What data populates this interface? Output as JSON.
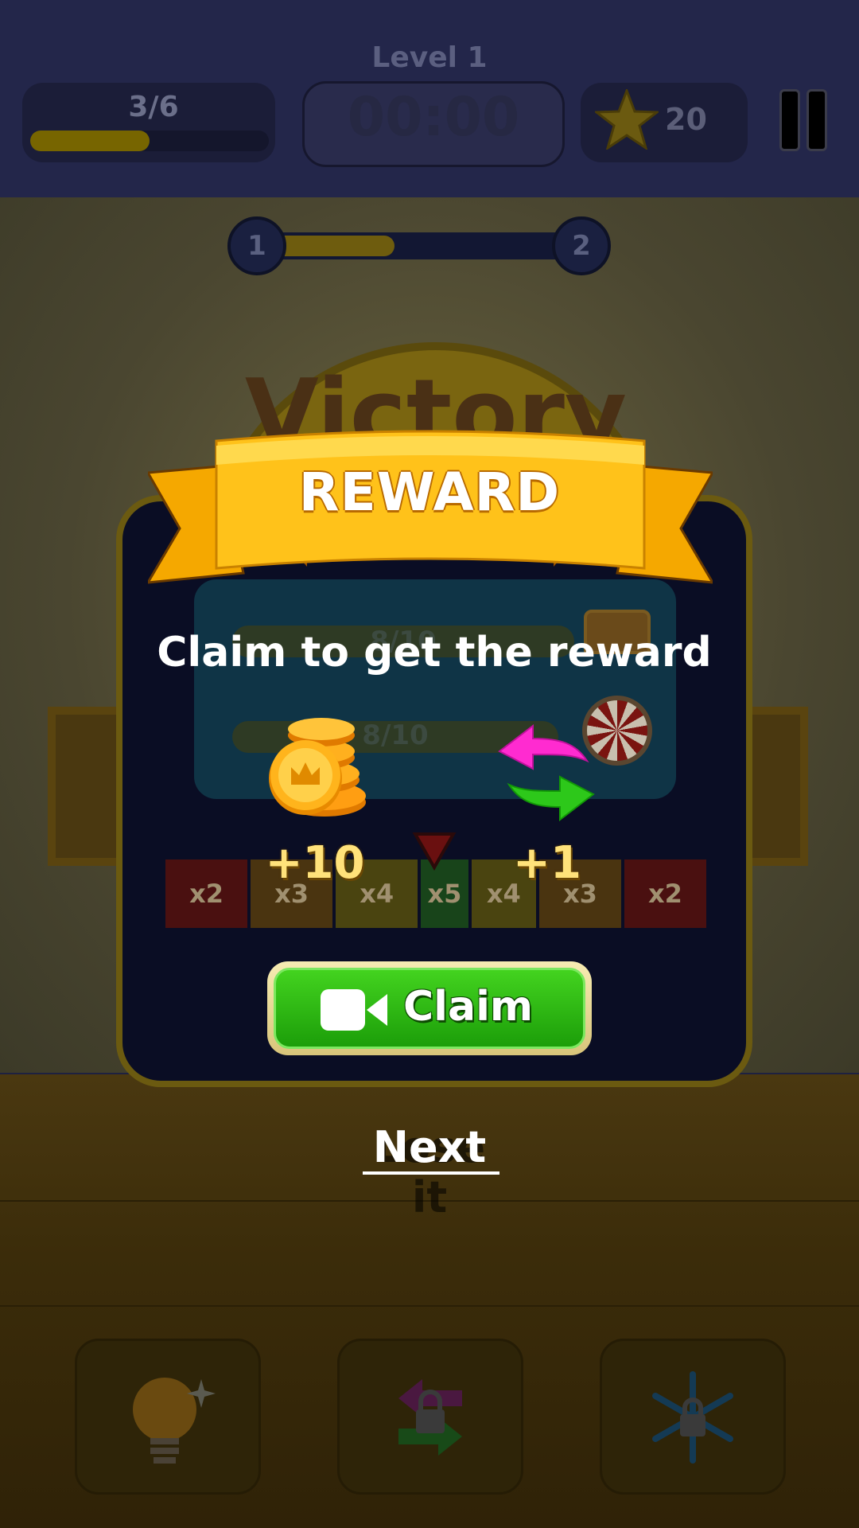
{
  "header": {
    "level_label": "Level 1",
    "progress_label": "3/6",
    "progress_fraction": 0.5,
    "timer": "00:00",
    "stars": "20"
  },
  "stage_progress": {
    "start_stage": "1",
    "end_stage": "2",
    "fill_fraction": 0.4
  },
  "victory_banner": "Victory",
  "background_panel": {
    "chest_bar_label": "8/10",
    "wheel_bar_label": "8/10",
    "multipliers": [
      {
        "label": "x2",
        "color": "#4a1010"
      },
      {
        "label": "x3",
        "color": "#4a3410"
      },
      {
        "label": "x4",
        "color": "#4a4410"
      },
      {
        "label": "x5",
        "color": "#18441a"
      },
      {
        "label": "x4",
        "color": "#4a4410"
      },
      {
        "label": "x3",
        "color": "#4a3410"
      },
      {
        "label": "x2",
        "color": "#4a1010"
      }
    ]
  },
  "reward_modal": {
    "title": "REWARD",
    "subtitle": "Claim to get the reward",
    "rewards": [
      {
        "icon": "coin-stack-icon",
        "amount": "+10"
      },
      {
        "icon": "swap-arrows-icon",
        "amount": "+1"
      }
    ],
    "claim_label": "Claim",
    "claim_icon": "video-camera-icon"
  },
  "footer": {
    "next_label": "Next",
    "lose_label": "Lose it"
  },
  "toolbar": [
    {
      "icon": "lightbulb-icon",
      "locked": false
    },
    {
      "icon": "swap-icon",
      "locked": true
    },
    {
      "icon": "snowflake-icon",
      "locked": true
    }
  ],
  "colors": {
    "accent_gold": "#ffc21a",
    "claim_green": "#2fbf14",
    "modal_bg": "#0a0d24"
  }
}
